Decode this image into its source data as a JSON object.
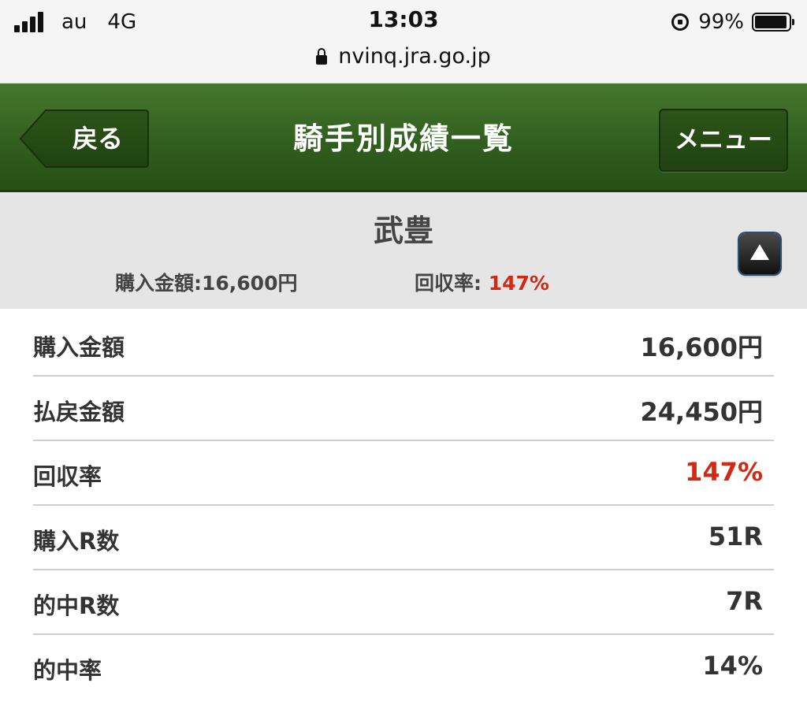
{
  "status_bar": {
    "carrier": "au",
    "network": "4G",
    "time": "13:03",
    "battery": "99%",
    "url": "nvinq.jra.go.jp"
  },
  "header": {
    "back_label": "戻る",
    "title": "騎手別成績一覧",
    "menu_label": "メニュー"
  },
  "summary": {
    "jockey_name": "武豊",
    "purchase_label": "購入金額:",
    "purchase_value": "16,600円",
    "recovery_label": "回収率: ",
    "recovery_value": "147%"
  },
  "stats": [
    {
      "label": "購入金額",
      "value": "16,600円"
    },
    {
      "label": "払戻金額",
      "value": "24,450円"
    },
    {
      "label": "回収率",
      "value": "147%"
    },
    {
      "label": "購入R数",
      "value": "51R"
    },
    {
      "label": "的中R数",
      "value": "7R"
    },
    {
      "label": "的中率",
      "value": "14%"
    }
  ],
  "colors": {
    "header_green": "#315f1f",
    "highlight_red": "#d22a12",
    "summary_gray": "#e5e5e5"
  }
}
